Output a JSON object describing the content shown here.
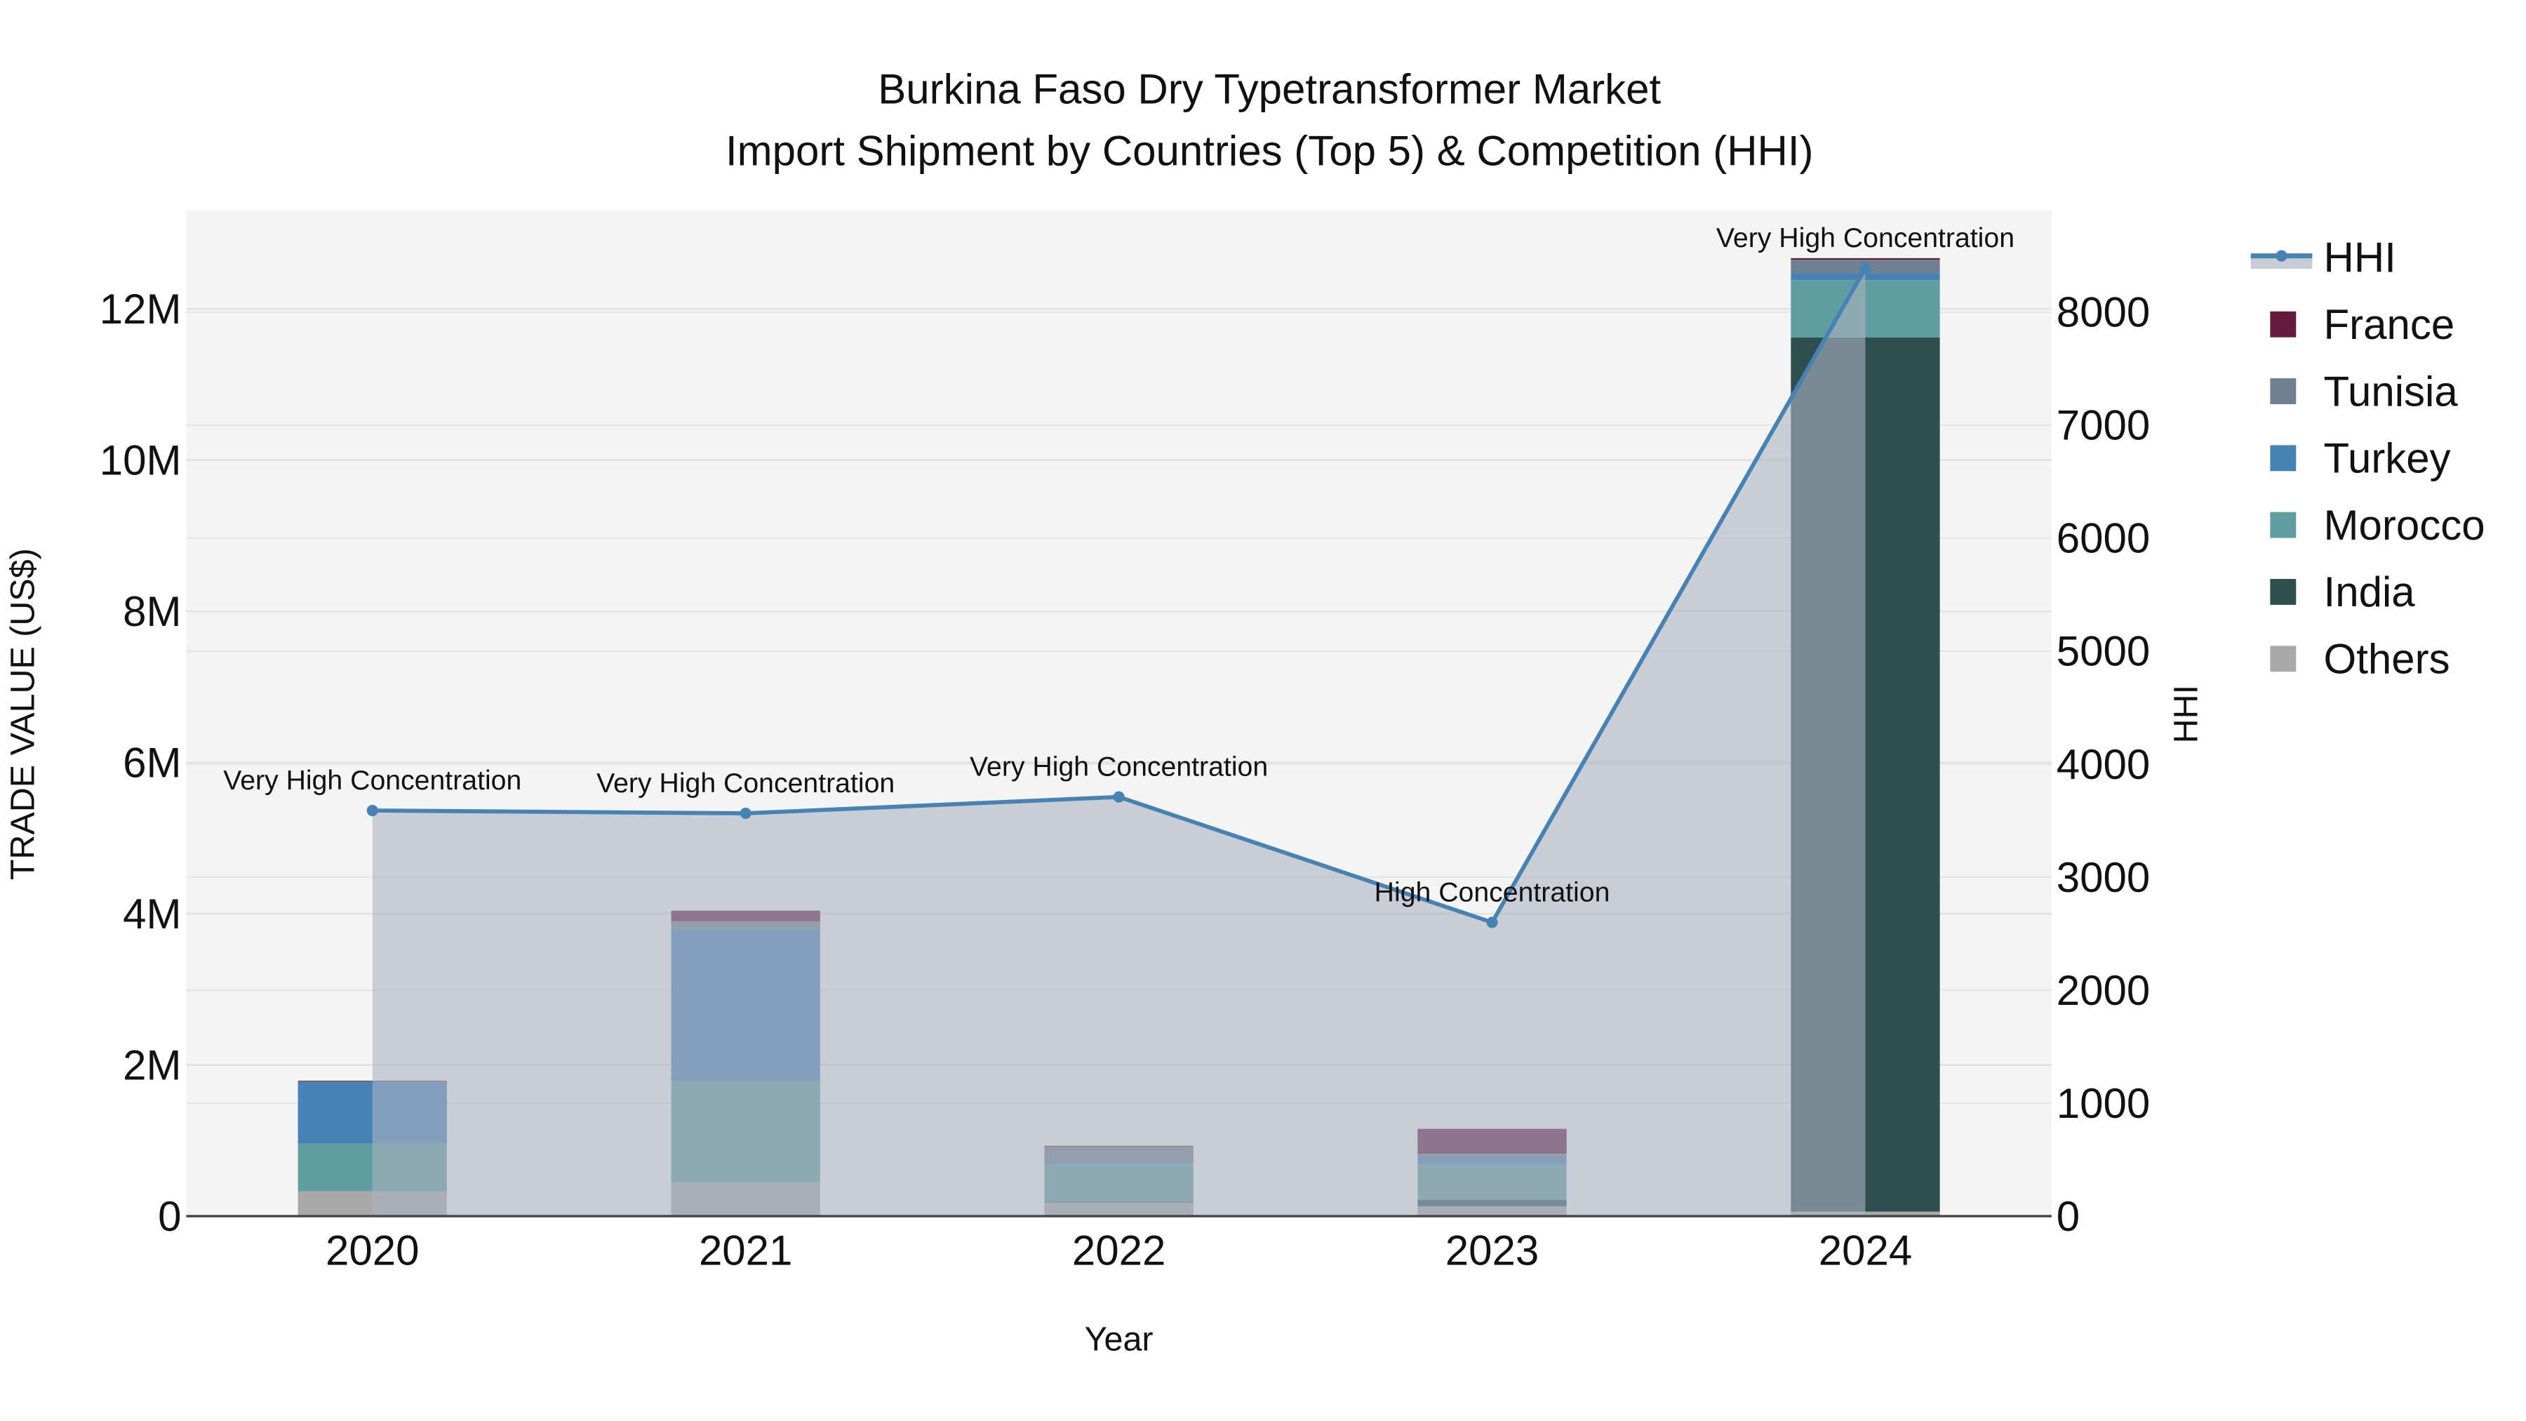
{
  "chart_data": {
    "type": "bar",
    "title_line1": "Burkina Faso Dry Typetransformer Market",
    "title_line2": "Import Shipment by Countries (Top 5) & Competition (HHI)",
    "xlabel": "Year",
    "ylabel": "TRADE VALUE (US$)",
    "y2label": "HHI",
    "categories": [
      "2020",
      "2021",
      "2022",
      "2023",
      "2024"
    ],
    "ylim": [
      0,
      13300000
    ],
    "y_ticks": [
      0,
      2000000,
      4000000,
      6000000,
      8000000,
      10000000,
      12000000
    ],
    "y_tick_labels": [
      "0",
      "2M",
      "4M",
      "6M",
      "8M",
      "10M",
      "12M"
    ],
    "y2lim": [
      0,
      8900
    ],
    "y2_ticks": [
      0,
      1000,
      2000,
      3000,
      4000,
      5000,
      6000,
      7000,
      8000
    ],
    "y2_tick_labels": [
      "0",
      "1000",
      "2000",
      "3000",
      "4000",
      "5000",
      "6000",
      "7000",
      "8000"
    ],
    "grid": true,
    "legend_position": "right",
    "series": [
      {
        "name": "Others",
        "color": "#a9a9a9",
        "values": [
          330000,
          450000,
          180000,
          130000,
          60000
        ]
      },
      {
        "name": "India",
        "color": "#2f4f4f",
        "values": [
          0,
          0,
          10000,
          85000,
          11560000
        ]
      },
      {
        "name": "Morocco",
        "color": "#5f9ea0",
        "values": [
          630000,
          1340000,
          500000,
          470000,
          760000
        ]
      },
      {
        "name": "Turkey",
        "color": "#4682b4",
        "values": [
          820000,
          2000000,
          20000,
          100000,
          90000
        ]
      },
      {
        "name": "Tunisia",
        "color": "#708090",
        "values": [
          0,
          110000,
          210000,
          40000,
          180000
        ]
      },
      {
        "name": "France",
        "color": "#641a3c",
        "values": [
          10000,
          140000,
          10000,
          330000,
          20000
        ]
      }
    ],
    "hhi": {
      "name": "HHI",
      "color": "#4682b4",
      "values": [
        3590,
        3565,
        3710,
        2600,
        8390
      ],
      "labels": [
        "Very High Concentration",
        "Very High Concentration",
        "Very High Concentration",
        "High Concentration",
        "Very High Concentration"
      ]
    },
    "legend": [
      "HHI",
      "France",
      "Tunisia",
      "Turkey",
      "Morocco",
      "India",
      "Others"
    ]
  }
}
